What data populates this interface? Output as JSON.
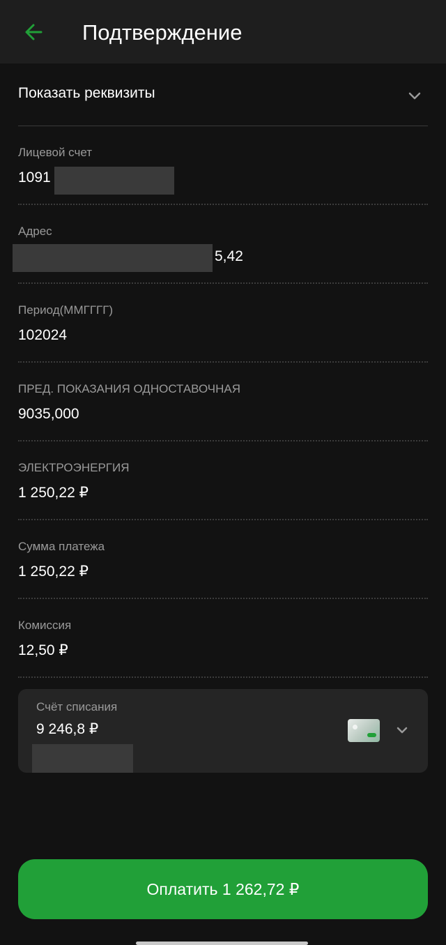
{
  "header": {
    "title": "Подтверждение",
    "back_icon": "arrow-left-icon",
    "accent_color": "#21a038"
  },
  "details_toggle": {
    "label": "Показать реквизиты",
    "icon": "chevron-down-icon"
  },
  "fields": [
    {
      "label": "Лицевой счет",
      "value": "1091"
    },
    {
      "label": "Адрес",
      "value": "5,42"
    },
    {
      "label": "Период(ММГГГГ)",
      "value": "102024"
    },
    {
      "label": "ПРЕД. ПОКАЗАНИЯ ОДНОСТАВОЧНАЯ",
      "value": "9035,000"
    },
    {
      "label": "ЭЛЕКТРОЭНЕРГИЯ",
      "value": "1 250,22 ₽"
    },
    {
      "label": "Сумма платежа",
      "value": "1 250,22 ₽"
    },
    {
      "label": "Комиссия",
      "value": "12,50 ₽"
    }
  ],
  "debit_account": {
    "label": "Счёт списания",
    "balance": "9 246,8 ₽",
    "card_icon": "bank-card-icon",
    "chevron_icon": "chevron-down-icon"
  },
  "pay_button": {
    "label": "Оплатить 1 262,72 ₽"
  }
}
